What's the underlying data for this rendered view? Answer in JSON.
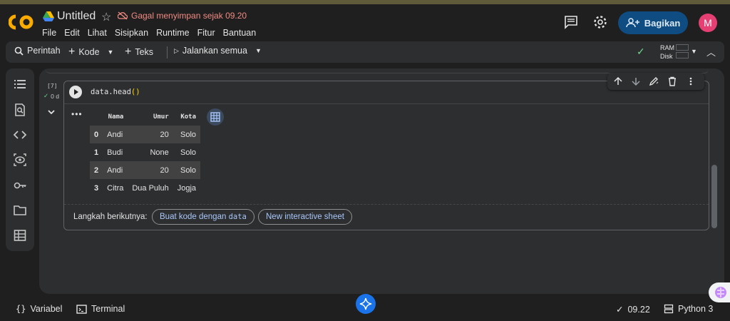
{
  "app": {
    "logo_text": "CO",
    "title": "Untitled",
    "save_status": "Gagal menyimpan sejak 09.20",
    "menu": [
      "File",
      "Edit",
      "Lihat",
      "Sisipkan",
      "Runtime",
      "Fitur",
      "Bantuan"
    ],
    "share_label": "Bagikan",
    "avatar_letter": "M"
  },
  "toolbar": {
    "command_label": "Perintah",
    "add_code_label": "Kode",
    "add_text_label": "Teks",
    "run_all_label": "Jalankan semua",
    "ram_label": "RAM",
    "disk_label": "Disk"
  },
  "sidebar": {
    "icons": [
      "toc-icon",
      "find-icon",
      "code-snippets-icon",
      "variables-inspector-icon",
      "secrets-key-icon",
      "files-folder-icon",
      "data-table-icon"
    ]
  },
  "cell": {
    "exec_count": "[7]",
    "exec_time": "0 d",
    "code_name": "data.head",
    "code_parens": "()",
    "output_menu": "•••",
    "table": {
      "columns": [
        "Nama",
        "Umur",
        "Kota"
      ],
      "rows": [
        {
          "idx": "0",
          "Nama": "Andi",
          "Umur": "20",
          "Kota": "Solo"
        },
        {
          "idx": "1",
          "Nama": "Budi",
          "Umur": "None",
          "Kota": "Solo"
        },
        {
          "idx": "2",
          "Nama": "Andi",
          "Umur": "20",
          "Kota": "Solo"
        },
        {
          "idx": "3",
          "Nama": "Citra",
          "Umur": "Dua Puluh",
          "Kota": "Jogja"
        }
      ]
    },
    "next_steps_label": "Langkah berikutnya:",
    "next_steps_button1_text": "Buat kode dengan",
    "next_steps_button1_code": "data",
    "next_steps_button2": "New interactive sheet"
  },
  "statusbar": {
    "variables_label": "Variabel",
    "terminal_label": "Terminal",
    "time": "09.22",
    "kernel": "Python 3"
  },
  "colors": {
    "accent_blue": "#0f4c81",
    "warning_red": "#f28b82",
    "link_blue": "#a8c7fa",
    "check_green": "#6dd58c",
    "logo_orange": "#f9ab00"
  }
}
